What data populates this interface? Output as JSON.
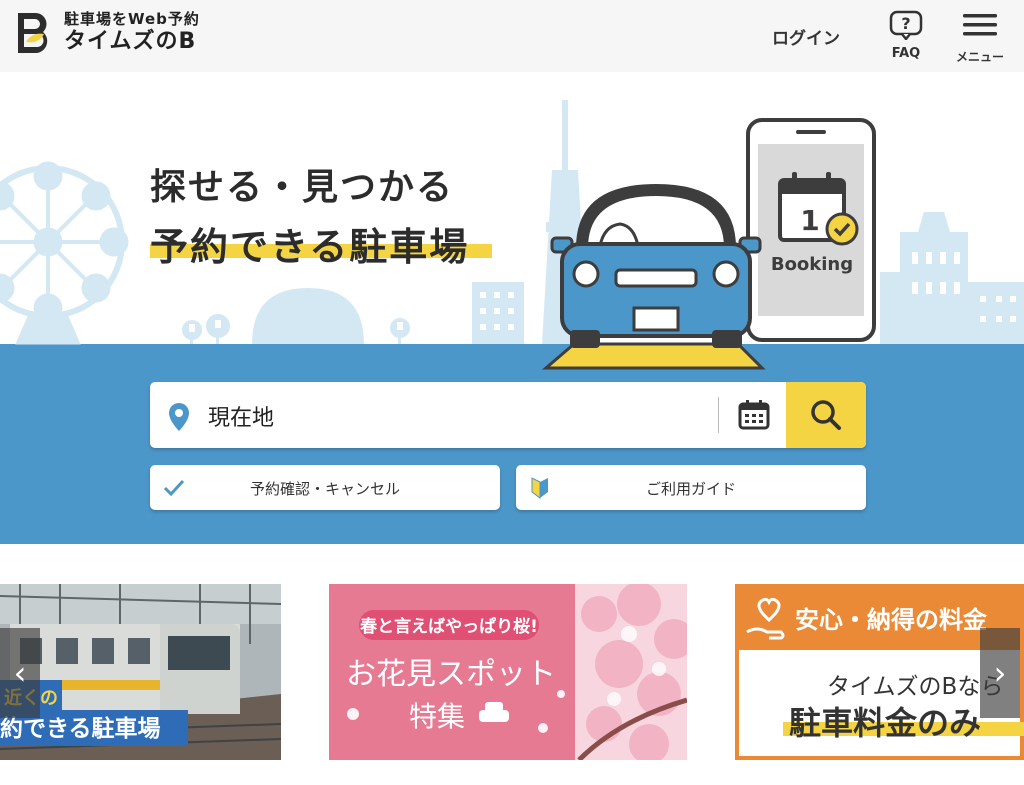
{
  "header": {
    "logo_tagline": "駐車場をWeb予約",
    "logo_name": "タイムズのB",
    "login_label": "ログイン",
    "faq_label": "FAQ",
    "menu_label": "メニュー"
  },
  "hero": {
    "headline_line1": "探せる・見つかる",
    "headline_line2": "予約できる駐車場",
    "phone_day": "1",
    "phone_label": "Booking"
  },
  "search": {
    "value": "現在地",
    "placeholder": "現在地"
  },
  "buttons": {
    "reservation": "予約確認・キャンセル",
    "guide": "ご利用ガイド"
  },
  "banners": [
    {
      "line1": "近くの",
      "line2": "約できる駐車場"
    },
    {
      "line1": "春と言えばやっぱり桜!",
      "line2": "お花見スポット",
      "line3": "特集"
    },
    {
      "line1": "安心・納得の料金",
      "line2": "タイムズのBなら",
      "line3": "駐車料金のみ"
    }
  ],
  "carousel": {
    "prev_icon": "‹",
    "next_icon": "›"
  },
  "colors": {
    "accent_yellow": "#f5d443",
    "hero_blue": "#4b97c9",
    "sky_blue": "#d4e8f4",
    "pink": "#e77a93",
    "orange": "#ea8a37"
  }
}
